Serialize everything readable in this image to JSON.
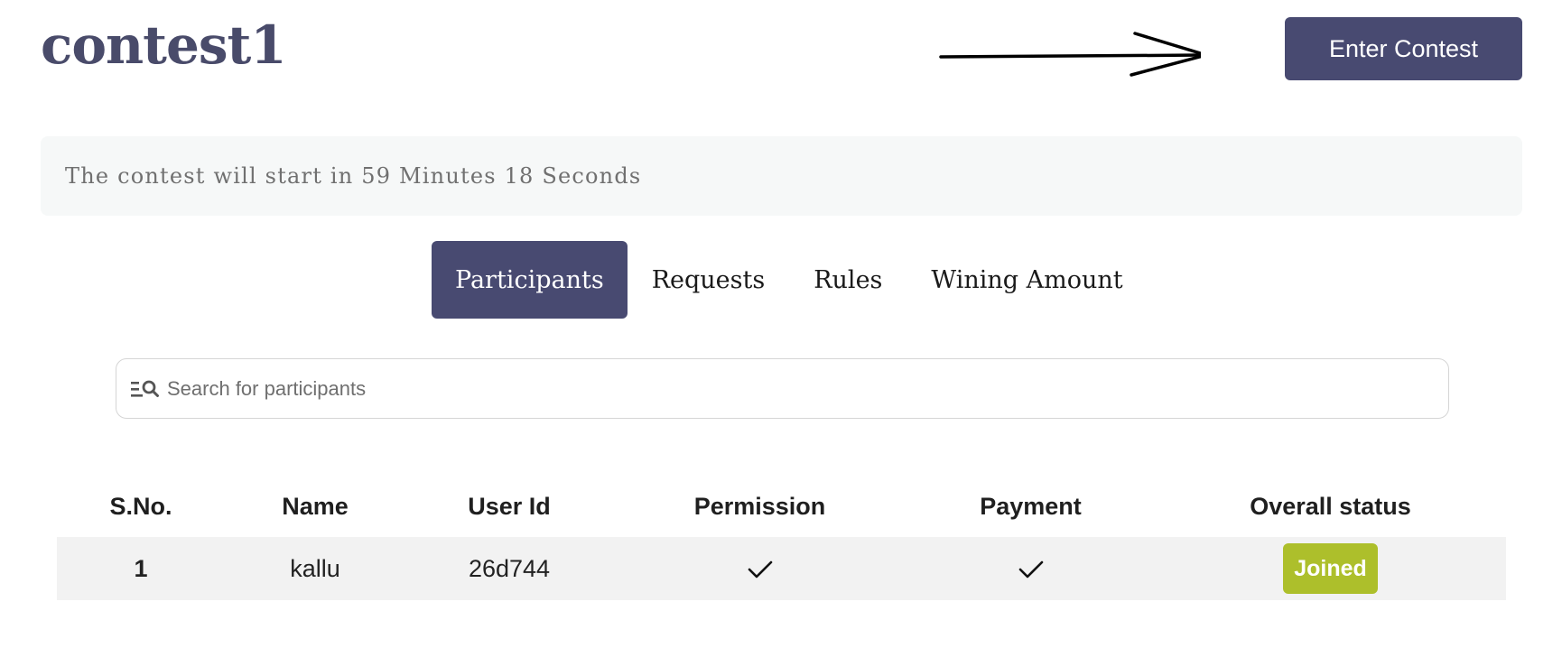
{
  "page_title": "contest1",
  "enter_button_label": "Enter Contest",
  "countdown": "The contest will start in 59 Minutes 18 Seconds",
  "tabs": [
    {
      "label": "Participants",
      "active": true
    },
    {
      "label": "Requests",
      "active": false
    },
    {
      "label": "Rules",
      "active": false
    },
    {
      "label": "Wining Amount",
      "active": false
    }
  ],
  "search": {
    "placeholder": "Search for participants",
    "value": "",
    "icon": "list-search-icon"
  },
  "table": {
    "headers": [
      "S.No.",
      "Name",
      "User Id",
      "Permission",
      "Payment",
      "Overall status"
    ],
    "rows": [
      {
        "sno": "1",
        "name": "kallu",
        "user_id": "26d744",
        "permission": "check-icon",
        "payment": "check-icon",
        "status": "Joined"
      }
    ]
  },
  "colors": {
    "primary": "#484a71",
    "title": "#494b6a",
    "status_joined": "#adbf2b",
    "countdown_bg": "#f6f8f8",
    "row_bg": "#f2f2f2"
  }
}
